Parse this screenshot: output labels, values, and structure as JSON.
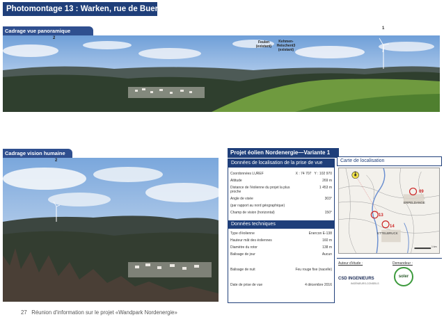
{
  "slide": {
    "title": "Photomontage 13 : Warken, rue de Buerden",
    "footer_number": "27",
    "footer_text": "Réunion d'information sur le projet «Wandpark Nordenergie»"
  },
  "panorama": {
    "tab_label": "Cadrage vue panoramique",
    "marker_left": "2",
    "label_feulen": "Feulen\n(existant)",
    "label_kehmen": "Kehmen-\nHeischent3\n(existant)",
    "marker_right": "1"
  },
  "human_view": {
    "tab_label": "Cadrage vision humaine",
    "marker": "2"
  },
  "info_panel": {
    "title": "Projet éolien Nordenergie—Variante 1",
    "location_section": "Données de localisation de la prise de vue",
    "coord_label": "Coordonnées LUREF",
    "coord_x": "X : 74 707",
    "coord_y": "Y : 102 970",
    "altitude_label": "Altitude",
    "altitude_value": "269 m",
    "distance_label": "Distance de l'éolienne du projet la plus proche",
    "distance_value": "1 453 m",
    "angle_label": "Angle de visée",
    "angle_sub": "(par rapport au nord géographique)",
    "angle_value": "303°",
    "field_label": "Champ de vision (horizontal)",
    "field_value": "150°",
    "tech_section": "Données techniques",
    "type_label": "Type d'éolienne",
    "type_value": "Enercon E-138",
    "hub_label": "Hauteur mât des éoliennes",
    "hub_value": "160 m",
    "rotor_label": "Diamètre du rotor",
    "rotor_value": "138 m",
    "daymark_label": "Balisage de jour",
    "daymark_value": "Aucun",
    "nightmark_label": "Balisage de nuit",
    "nightmark_value": "Feu rouge fixe (nacelle)",
    "date_label": "Date de prise de vue",
    "date_value": "4 décembre 2016"
  },
  "map": {
    "header": "Carte de localisation",
    "point_label": "1",
    "turbine_a": "09",
    "turbine_b": "13",
    "turbine_c": "14",
    "town_a": "ERPELDANGE",
    "town_b": "ETTELBRUCK",
    "scale_label": "1 km"
  },
  "credits": {
    "author_label": "Auteur d'étude :",
    "client_label": "Demandeur :",
    "author_name": "CSD INGENIEURS",
    "author_sub": "INGÉNIEURS-CONSEILS",
    "client_name": "soler"
  }
}
